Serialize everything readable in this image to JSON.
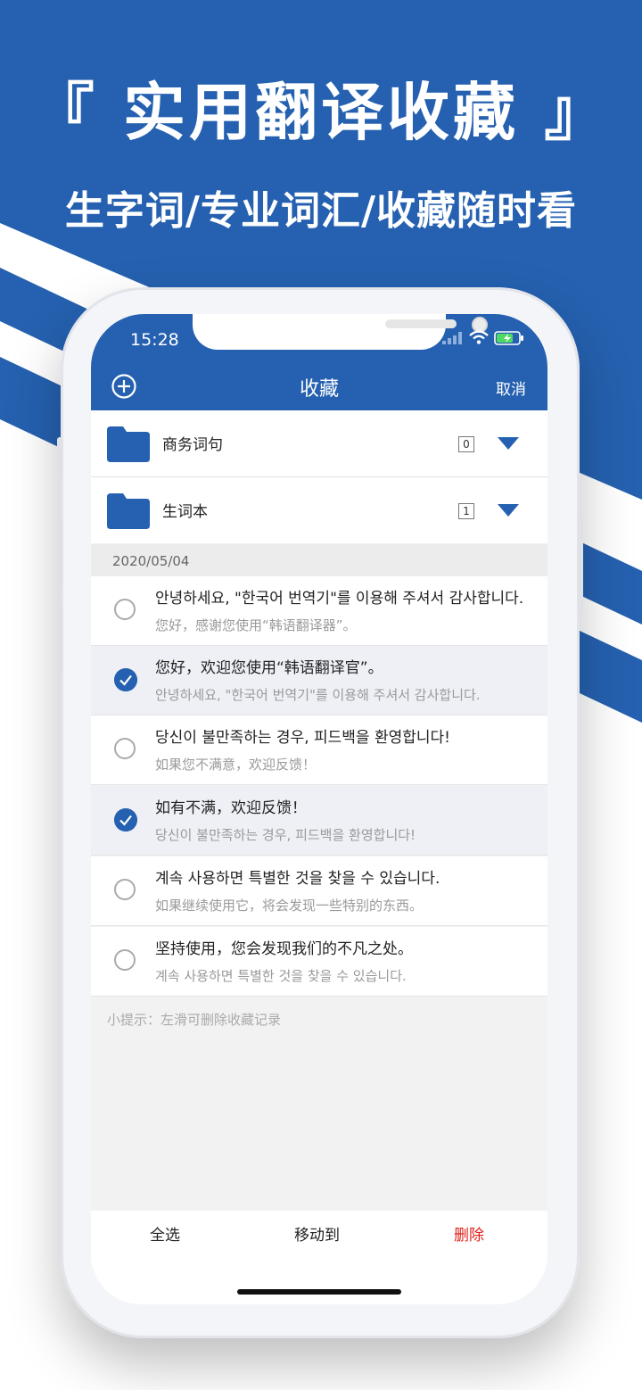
{
  "promo": {
    "headline": "『 实用翻译收藏 』",
    "subline": "生字词/专业词汇/收藏随时看"
  },
  "colors": {
    "brand_blue": "#2561b0",
    "delete_red": "#e0201b"
  },
  "status_bar": {
    "time": "15:28"
  },
  "nav": {
    "title": "收藏",
    "cancel": "取消",
    "add_icon": "plus-circle-icon"
  },
  "folders": [
    {
      "name": "商务词句",
      "count": "0"
    },
    {
      "name": "生词本",
      "count": "1"
    }
  ],
  "date_header": "2020/05/04",
  "items": [
    {
      "main": "안녕하세요, \"한국어 번역기\"를 이용해 주셔서 감사합니다.",
      "sub": "您好，感谢您使用“韩语翻译器”。",
      "selected": false
    },
    {
      "main": "您好，欢迎您使用“韩语翻译官”。",
      "sub": "안녕하세요, \"한국어 번역기\"를 이용해 주셔서 감사합니다.",
      "selected": true
    },
    {
      "main": "당신이 불만족하는 경우, 피드백을 환영합니다!",
      "sub": "如果您不满意，欢迎反馈！",
      "selected": false
    },
    {
      "main": "如有不满，欢迎反馈！",
      "sub": "당신이 불만족하는 경우, 피드백을 환영합니다!",
      "selected": true
    },
    {
      "main": "계속 사용하면 특별한 것을 찾을 수 있습니다.",
      "sub": "如果继续使用它，将会发现一些特别的东西。",
      "selected": false
    },
    {
      "main": "坚持使用，您会发现我们的不凡之处。",
      "sub": "계속 사용하면 특별한 것을 찾을 수 있습니다.",
      "selected": false
    }
  ],
  "tip": "小提示：左滑可删除收藏记录",
  "bottom_bar": {
    "select_all": "全选",
    "move_to": "移动到",
    "delete": "删除"
  }
}
